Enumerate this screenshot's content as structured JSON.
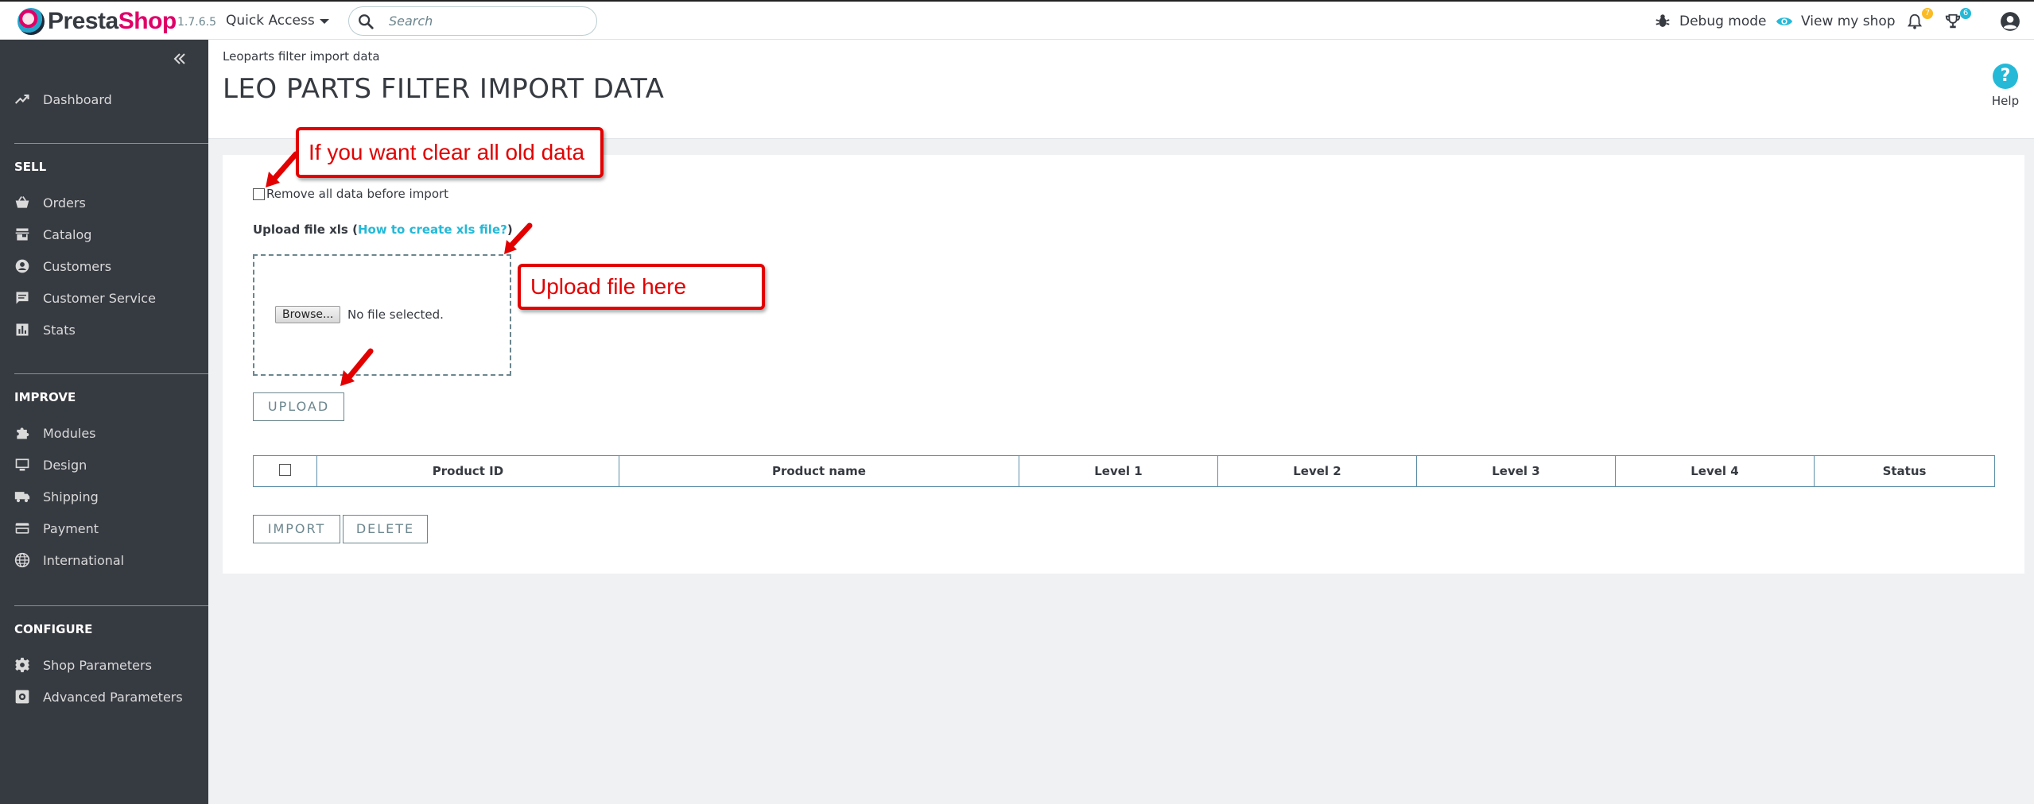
{
  "header": {
    "brand_presta": "Presta",
    "brand_shop": "Shop",
    "version": "1.7.6.5",
    "quick_access": "Quick Access",
    "search_placeholder": "Search",
    "debug_mode": "Debug mode",
    "view_shop": "View my shop",
    "notifications_count": "7",
    "orders_count": "6"
  },
  "sidebar": {
    "dashboard": "Dashboard",
    "sections": [
      {
        "title": "SELL",
        "items": [
          "Orders",
          "Catalog",
          "Customers",
          "Customer Service",
          "Stats"
        ]
      },
      {
        "title": "IMPROVE",
        "items": [
          "Modules",
          "Design",
          "Shipping",
          "Payment",
          "International"
        ]
      },
      {
        "title": "CONFIGURE",
        "items": [
          "Shop Parameters",
          "Advanced Parameters"
        ]
      }
    ]
  },
  "page": {
    "breadcrumb": "Leoparts filter import data",
    "title": "LEO PARTS FILTER IMPORT DATA",
    "help": "Help"
  },
  "form": {
    "remove_label": "Remove all data before import",
    "upload_label": "Upload file xls (",
    "upload_link": "How to create xls file?",
    "upload_label_end": ")",
    "browse": "Browse...",
    "no_file": "No file selected.",
    "upload_button": "UPLOAD",
    "import_button": "IMPORT",
    "delete_button": "DELETE"
  },
  "table": {
    "columns": [
      "Product ID",
      "Product name",
      "Level 1",
      "Level 2",
      "Level 3",
      "Level 4",
      "Status"
    ]
  },
  "annotations": {
    "clear_data": "If you want clear all old data",
    "upload_here": "Upload file here"
  },
  "colors": {
    "brand_pink": "#df0067",
    "accent_blue": "#25b9d7",
    "sidebar_bg": "#363a41",
    "annotation_red": "#e20000"
  }
}
